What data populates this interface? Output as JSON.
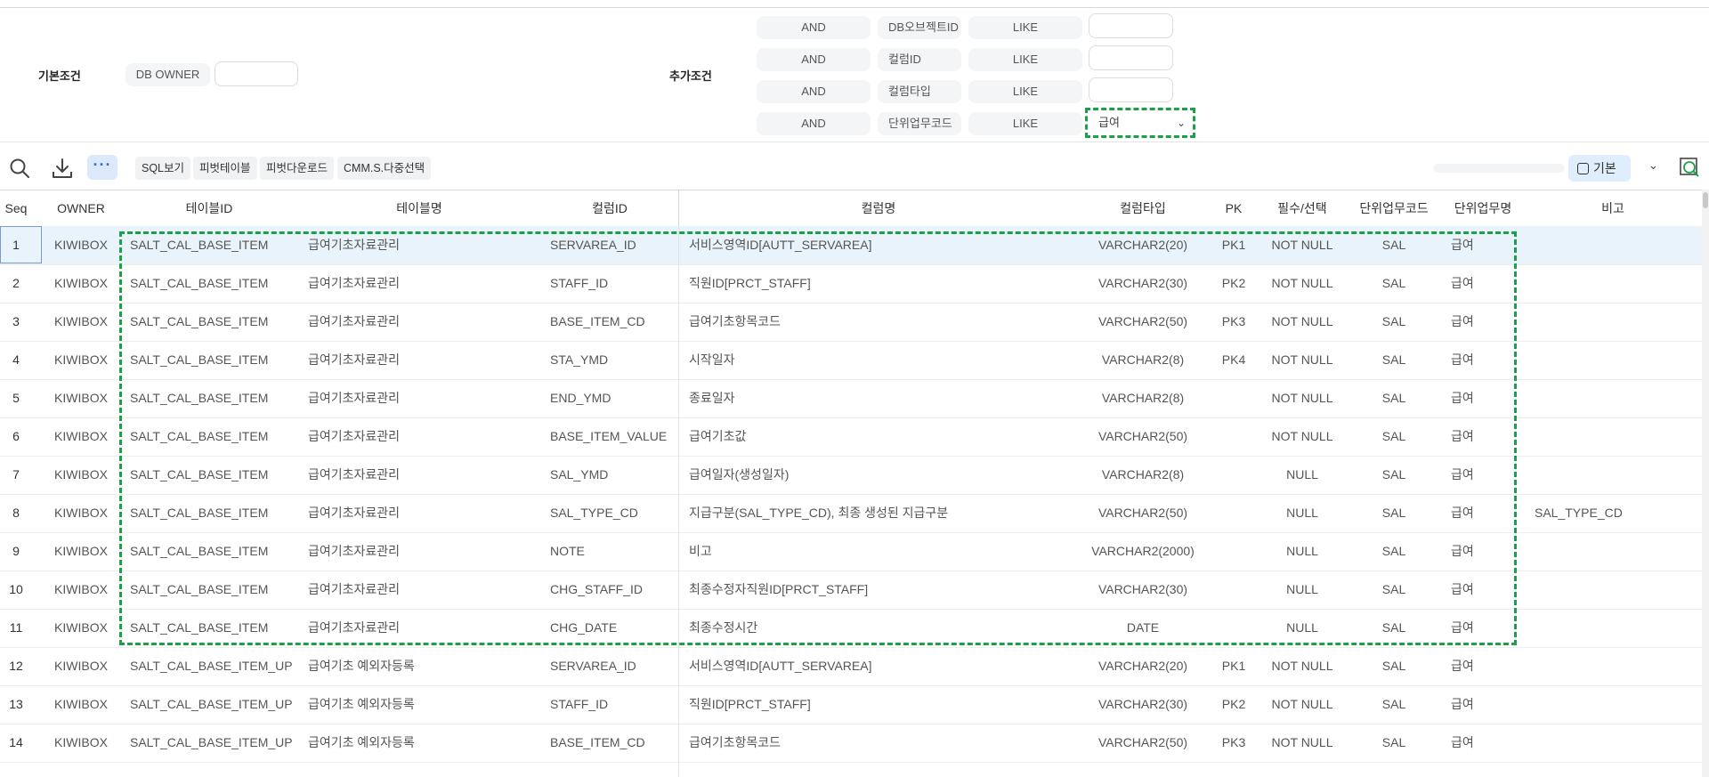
{
  "conditions": {
    "basic_label": "기본조건",
    "extra_label": "추가조건",
    "db_owner_label": "DB OWNER",
    "db_owner_value": "",
    "rows": [
      {
        "logic": "AND",
        "field": "DB오브젝트ID",
        "op": "LIKE",
        "value": ""
      },
      {
        "logic": "AND",
        "field": "컬럼ID",
        "op": "LIKE",
        "value": ""
      },
      {
        "logic": "AND",
        "field": "컬럼타입",
        "op": "LIKE",
        "value": ""
      },
      {
        "logic": "AND",
        "field": "단위업무코드",
        "op": "LIKE",
        "value": "급여"
      }
    ]
  },
  "toolbar": {
    "buttons": [
      "SQL보기",
      "피벗테이블",
      "피벗다운로드",
      "CMM.S.다중선택"
    ],
    "view_label": "기본",
    "icons": [
      "search-icon",
      "download-icon",
      "more-icon",
      "chevron-down-icon",
      "excel-export-icon"
    ]
  },
  "grid": {
    "columns": [
      "Seq",
      "OWNER",
      "테이블ID",
      "테이블명",
      "컬럼ID",
      "컬럼명",
      "컬럼타입",
      "PK",
      "필수/선택",
      "단위업무코드",
      "단위업무명",
      "비고"
    ],
    "rows": [
      [
        "1",
        "KIWIBOX",
        "SALT_CAL_BASE_ITEM",
        "급여기초자료관리",
        "SERVAREA_ID",
        "서비스영역ID[AUTT_SERVAREA]",
        "VARCHAR2(20)",
        "PK1",
        "NOT NULL",
        "SAL",
        "급여",
        ""
      ],
      [
        "2",
        "KIWIBOX",
        "SALT_CAL_BASE_ITEM",
        "급여기초자료관리",
        "STAFF_ID",
        "직원ID[PRCT_STAFF]",
        "VARCHAR2(30)",
        "PK2",
        "NOT NULL",
        "SAL",
        "급여",
        ""
      ],
      [
        "3",
        "KIWIBOX",
        "SALT_CAL_BASE_ITEM",
        "급여기초자료관리",
        "BASE_ITEM_CD",
        "급여기초항목코드",
        "VARCHAR2(50)",
        "PK3",
        "NOT NULL",
        "SAL",
        "급여",
        ""
      ],
      [
        "4",
        "KIWIBOX",
        "SALT_CAL_BASE_ITEM",
        "급여기초자료관리",
        "STA_YMD",
        "시작일자",
        "VARCHAR2(8)",
        "PK4",
        "NOT NULL",
        "SAL",
        "급여",
        ""
      ],
      [
        "5",
        "KIWIBOX",
        "SALT_CAL_BASE_ITEM",
        "급여기초자료관리",
        "END_YMD",
        "종료일자",
        "VARCHAR2(8)",
        "",
        "NOT NULL",
        "SAL",
        "급여",
        ""
      ],
      [
        "6",
        "KIWIBOX",
        "SALT_CAL_BASE_ITEM",
        "급여기초자료관리",
        "BASE_ITEM_VALUE",
        "급여기초값",
        "VARCHAR2(50)",
        "",
        "NOT NULL",
        "SAL",
        "급여",
        ""
      ],
      [
        "7",
        "KIWIBOX",
        "SALT_CAL_BASE_ITEM",
        "급여기초자료관리",
        "SAL_YMD",
        "급여일자(생성일자)",
        "VARCHAR2(8)",
        "",
        "NULL",
        "SAL",
        "급여",
        ""
      ],
      [
        "8",
        "KIWIBOX",
        "SALT_CAL_BASE_ITEM",
        "급여기초자료관리",
        "SAL_TYPE_CD",
        "지급구분(SAL_TYPE_CD), 최종 생성된 지급구분",
        "VARCHAR2(50)",
        "",
        "NULL",
        "SAL",
        "급여",
        "SAL_TYPE_CD"
      ],
      [
        "9",
        "KIWIBOX",
        "SALT_CAL_BASE_ITEM",
        "급여기초자료관리",
        "NOTE",
        "비고",
        "VARCHAR2(2000)",
        "",
        "NULL",
        "SAL",
        "급여",
        ""
      ],
      [
        "10",
        "KIWIBOX",
        "SALT_CAL_BASE_ITEM",
        "급여기초자료관리",
        "CHG_STAFF_ID",
        "최종수정자직원ID[PRCT_STAFF]",
        "VARCHAR2(30)",
        "",
        "NULL",
        "SAL",
        "급여",
        ""
      ],
      [
        "11",
        "KIWIBOX",
        "SALT_CAL_BASE_ITEM",
        "급여기초자료관리",
        "CHG_DATE",
        "최종수정시간",
        "DATE",
        "",
        "NULL",
        "SAL",
        "급여",
        ""
      ],
      [
        "12",
        "KIWIBOX",
        "SALT_CAL_BASE_ITEM_UP",
        "급여기초 예외자등록",
        "SERVAREA_ID",
        "서비스영역ID[AUTT_SERVAREA]",
        "VARCHAR2(20)",
        "PK1",
        "NOT NULL",
        "SAL",
        "급여",
        ""
      ],
      [
        "13",
        "KIWIBOX",
        "SALT_CAL_BASE_ITEM_UP",
        "급여기초 예외자등록",
        "STAFF_ID",
        "직원ID[PRCT_STAFF]",
        "VARCHAR2(30)",
        "PK2",
        "NOT NULL",
        "SAL",
        "급여",
        ""
      ],
      [
        "14",
        "KIWIBOX",
        "SALT_CAL_BASE_ITEM_UP",
        "급여기초 예외자등록",
        "BASE_ITEM_CD",
        "급여기초항목코드",
        "VARCHAR2(50)",
        "PK3",
        "NOT NULL",
        "SAL",
        "급여",
        ""
      ]
    ],
    "selected_row": 0,
    "highlight_color": "#1aa046"
  }
}
